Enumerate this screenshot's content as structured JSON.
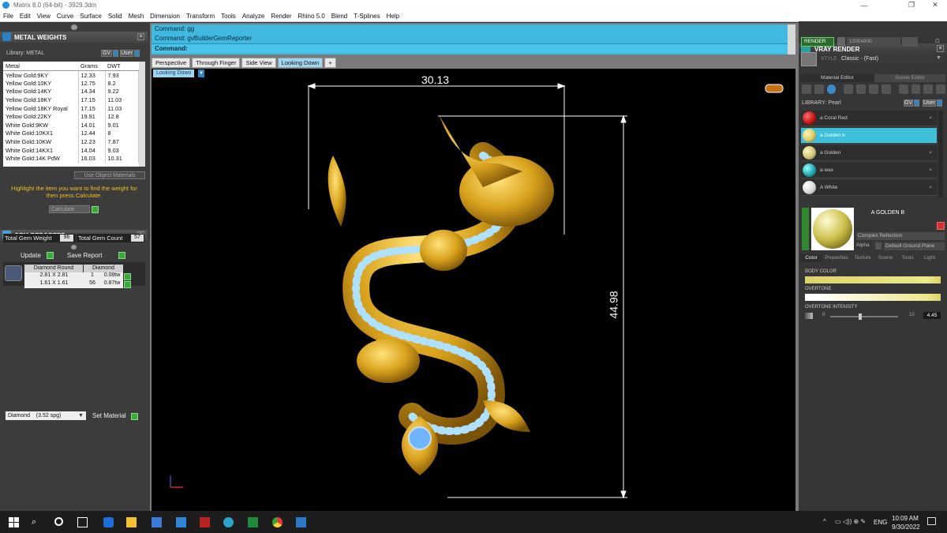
{
  "window": {
    "title": "Matrix 8.0 (64-bit) - 3929.3dm"
  },
  "menu": [
    "File",
    "Edit",
    "View",
    "Curve",
    "Surface",
    "Solid",
    "Mesh",
    "Dimension",
    "Transform",
    "Tools",
    "Analyze",
    "Render",
    "Rhino 5.0",
    "Blend",
    "T-Splines",
    "Help"
  ],
  "metal_weights": {
    "title": "METAL WEIGHTS",
    "library_label": "Library: METAL",
    "library_buttons": [
      "GV",
      "User"
    ],
    "columns": [
      "Metal",
      "Grams",
      "DWT"
    ],
    "rows": [
      [
        "Yellow Gold:9KY",
        "12.33",
        "7.93"
      ],
      [
        "Yellow Gold:10KY",
        "12.75",
        "8.2"
      ],
      [
        "Yellow Gold:14KY",
        "14.34",
        "9.22"
      ],
      [
        "Yellow Gold:18KY",
        "17.15",
        "11.03"
      ],
      [
        "Yellow Gold:18KY Royal",
        "17.15",
        "11.03"
      ],
      [
        "Yellow Gold:22KY",
        "19.91",
        "12.8"
      ],
      [
        "White Gold:9KW",
        "14.01",
        "9.01"
      ],
      [
        "White Gold:10KX1",
        "12.44",
        "8"
      ],
      [
        "White Gold:10KW",
        "12.23",
        "7.87"
      ],
      [
        "White Gold:14KX1",
        "14.04",
        "9.03"
      ],
      [
        "White Gold:14K PdW",
        "16.03",
        "10.31"
      ]
    ],
    "use_object_materials": "Use Object Materials",
    "instruction": "Highlight the item you want to find the weight for then press Calculate.",
    "calculate": "Calculate"
  },
  "gem_reporter": {
    "title": "GEM REPORTER",
    "total_weight_label": "Total Gem Weight",
    "total_weight": "96",
    "total_count_label": "Total Gem Count",
    "total_count": "57",
    "update": "Update",
    "save_report": "Save Report",
    "columns": [
      "Diamond Round",
      "Diamond"
    ],
    "rows": [
      [
        "2.81 X 2.81",
        "1",
        "0.08tw"
      ],
      [
        "1.61 X 1.61",
        "56",
        "0.87tw"
      ]
    ],
    "gem_select": "Diamond    (3.52 spg)",
    "set_material": "Set Material"
  },
  "command": {
    "history": [
      "Command: gg",
      "Command: gvBuilderGemReporter"
    ],
    "prompt": "Command:"
  },
  "tabs": [
    "Perspective",
    "Through Finger",
    "Side View",
    "Looking Down",
    "+"
  ],
  "active_tab": "Looking Down",
  "viewport": {
    "label": "Looking Down",
    "dim_width": "30.13",
    "dim_height": "44.98"
  },
  "vray": {
    "title": "VRAY RENDER",
    "render_button": "RENDER",
    "resolution": "1200x900",
    "style_label": "STYLE",
    "style_value": "Classic - (Fast)",
    "tabs": [
      "Material Editor",
      "Scene Editor"
    ],
    "library_label": "LIBRARY: Pearl",
    "library_buttons": [
      "GV",
      "User"
    ],
    "materials": [
      {
        "name": "a Coral Red",
        "color": "#c0181a"
      },
      {
        "name": "a Golden b",
        "color": "#d8cc6a"
      },
      {
        "name": "a Golden",
        "color": "#cfc67a"
      },
      {
        "name": "a wax",
        "color": "#1fa7b0"
      },
      {
        "name": "A White",
        "color": "#d8d8d8"
      }
    ],
    "selected_material": "a Golden b",
    "preview_title": "A GOLDEN B",
    "reflection": "Complex Reflection",
    "alpha_label": "Alpha",
    "ground": "Default Ground Plane",
    "sub_tabs": [
      "Color",
      "Properties",
      "Texture",
      "Scene",
      "Tools",
      "Light"
    ],
    "body_color_label": "BODY COLOR",
    "overtone_label": "OVERTONE",
    "overtone_intensity_label": "OVERTONE INTENSITY",
    "intensity_min": "0",
    "intensity_max": "10",
    "intensity_value": "4.45",
    "intensity_fraction": 0.445
  },
  "taskbar": {
    "language": "ENG",
    "time": "10:09 AM",
    "date": "9/30/2022"
  }
}
